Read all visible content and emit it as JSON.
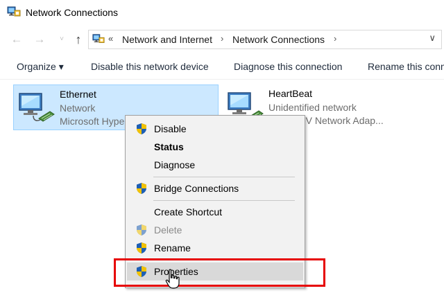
{
  "window": {
    "title": "Network Connections",
    "title_icon": "network-connections-icon"
  },
  "navigation": {
    "back_icon": "arrow-left-icon",
    "forward_icon": "arrow-right-icon",
    "recent_icon": "chevron-down-icon",
    "up_icon": "arrow-up-icon",
    "back_glyph": "←",
    "forward_glyph": "→",
    "recent_glyph": "˅",
    "up_glyph": "↑"
  },
  "address": {
    "overflow_glyph": "«",
    "crumbs": [
      "Network and Internet",
      "Network Connections"
    ],
    "separator": "›",
    "dropdown_glyph": "∨"
  },
  "commands": {
    "organize": "Organize ▾",
    "disable": "Disable this network device",
    "diagnose": "Diagnose this connection",
    "rename": "Rename this conn"
  },
  "connections": [
    {
      "name": "Ethernet",
      "status": "Network",
      "adapter": "Microsoft Hype",
      "selected": true
    },
    {
      "name": "HeartBeat",
      "status": "Unidentified network",
      "adapter": "ft Hyper-V Network Adap...",
      "selected": false
    }
  ],
  "context_menu": {
    "items": [
      {
        "label": "Disable",
        "shield": true,
        "bold": false,
        "disabled": false
      },
      {
        "label": "Status",
        "shield": false,
        "bold": true,
        "disabled": false
      },
      {
        "label": "Diagnose",
        "shield": false,
        "bold": false,
        "disabled": false
      },
      {
        "label": "Bridge Connections",
        "shield": true,
        "bold": false,
        "disabled": false
      },
      {
        "label": "Create Shortcut",
        "shield": false,
        "bold": false,
        "disabled": false
      },
      {
        "label": "Delete",
        "shield": true,
        "bold": false,
        "disabled": true
      },
      {
        "label": "Rename",
        "shield": true,
        "bold": false,
        "disabled": false
      },
      {
        "label": "Properties",
        "shield": true,
        "bold": false,
        "disabled": false,
        "hovered": true
      }
    ]
  },
  "colors": {
    "selection_bg": "#cce8ff",
    "selection_border": "#99d1ff",
    "menu_bg": "#f2f2f2",
    "menu_hover": "#d9d9d9",
    "highlight_annotation": "#e60000",
    "shield_blue": "#1e5fb4",
    "shield_yellow": "#f2c200"
  }
}
